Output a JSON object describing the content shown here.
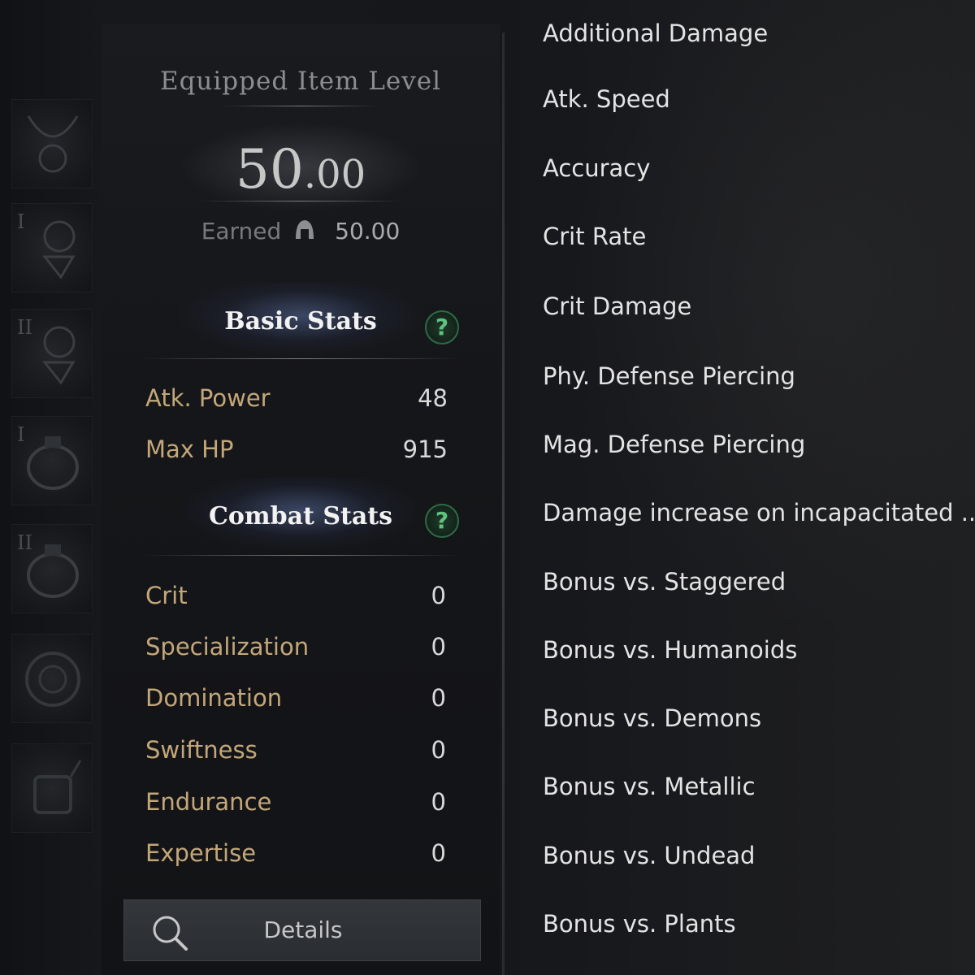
{
  "item_level": {
    "title": "Equipped Item Level",
    "value_int": "50",
    "value_dec": ".00",
    "earned_label": "Earned",
    "earned_value": "50.00"
  },
  "basic_stats": {
    "title": "Basic Stats",
    "help": "?",
    "rows": [
      {
        "label": "Atk. Power",
        "value": "48"
      },
      {
        "label": "Max HP",
        "value": "915"
      }
    ]
  },
  "combat_stats": {
    "title": "Combat Stats",
    "help": "?",
    "rows": [
      {
        "label": "Crit",
        "value": "0"
      },
      {
        "label": "Specialization",
        "value": "0"
      },
      {
        "label": "Domination",
        "value": "0"
      },
      {
        "label": "Swiftness",
        "value": "0"
      },
      {
        "label": "Endurance",
        "value": "0"
      },
      {
        "label": "Expertise",
        "value": "0"
      }
    ]
  },
  "details_button": {
    "label": "Details",
    "icon": "search-icon"
  },
  "equipment_slots": [
    {
      "tier": "",
      "icon": "necklace-icon"
    },
    {
      "tier": "I",
      "icon": "earring-icon"
    },
    {
      "tier": "II",
      "icon": "earring-icon"
    },
    {
      "tier": "I",
      "icon": "ring-icon"
    },
    {
      "tier": "II",
      "icon": "ring-icon"
    },
    {
      "tier": "",
      "icon": "ability-stone-icon"
    },
    {
      "tier": "",
      "icon": "bracelet-icon"
    }
  ],
  "right_stats": [
    "Additional Damage",
    "Atk. Speed",
    "Accuracy",
    "Crit Rate",
    "Crit Damage",
    "Phy. Defense Piercing",
    "Mag. Defense Piercing",
    "Damage increase on incapacitated ...",
    "Bonus vs. Staggered",
    "Bonus vs. Humanoids",
    "Bonus vs. Demons",
    "Bonus vs. Metallic",
    "Bonus vs. Undead",
    "Bonus vs. Plants"
  ],
  "colors": {
    "background": "#15171b",
    "stat_label": "#c3a779",
    "stat_value": "#d9d9d9",
    "help_icon": "#5fc27e",
    "section_glow": "#5a6ea0"
  }
}
